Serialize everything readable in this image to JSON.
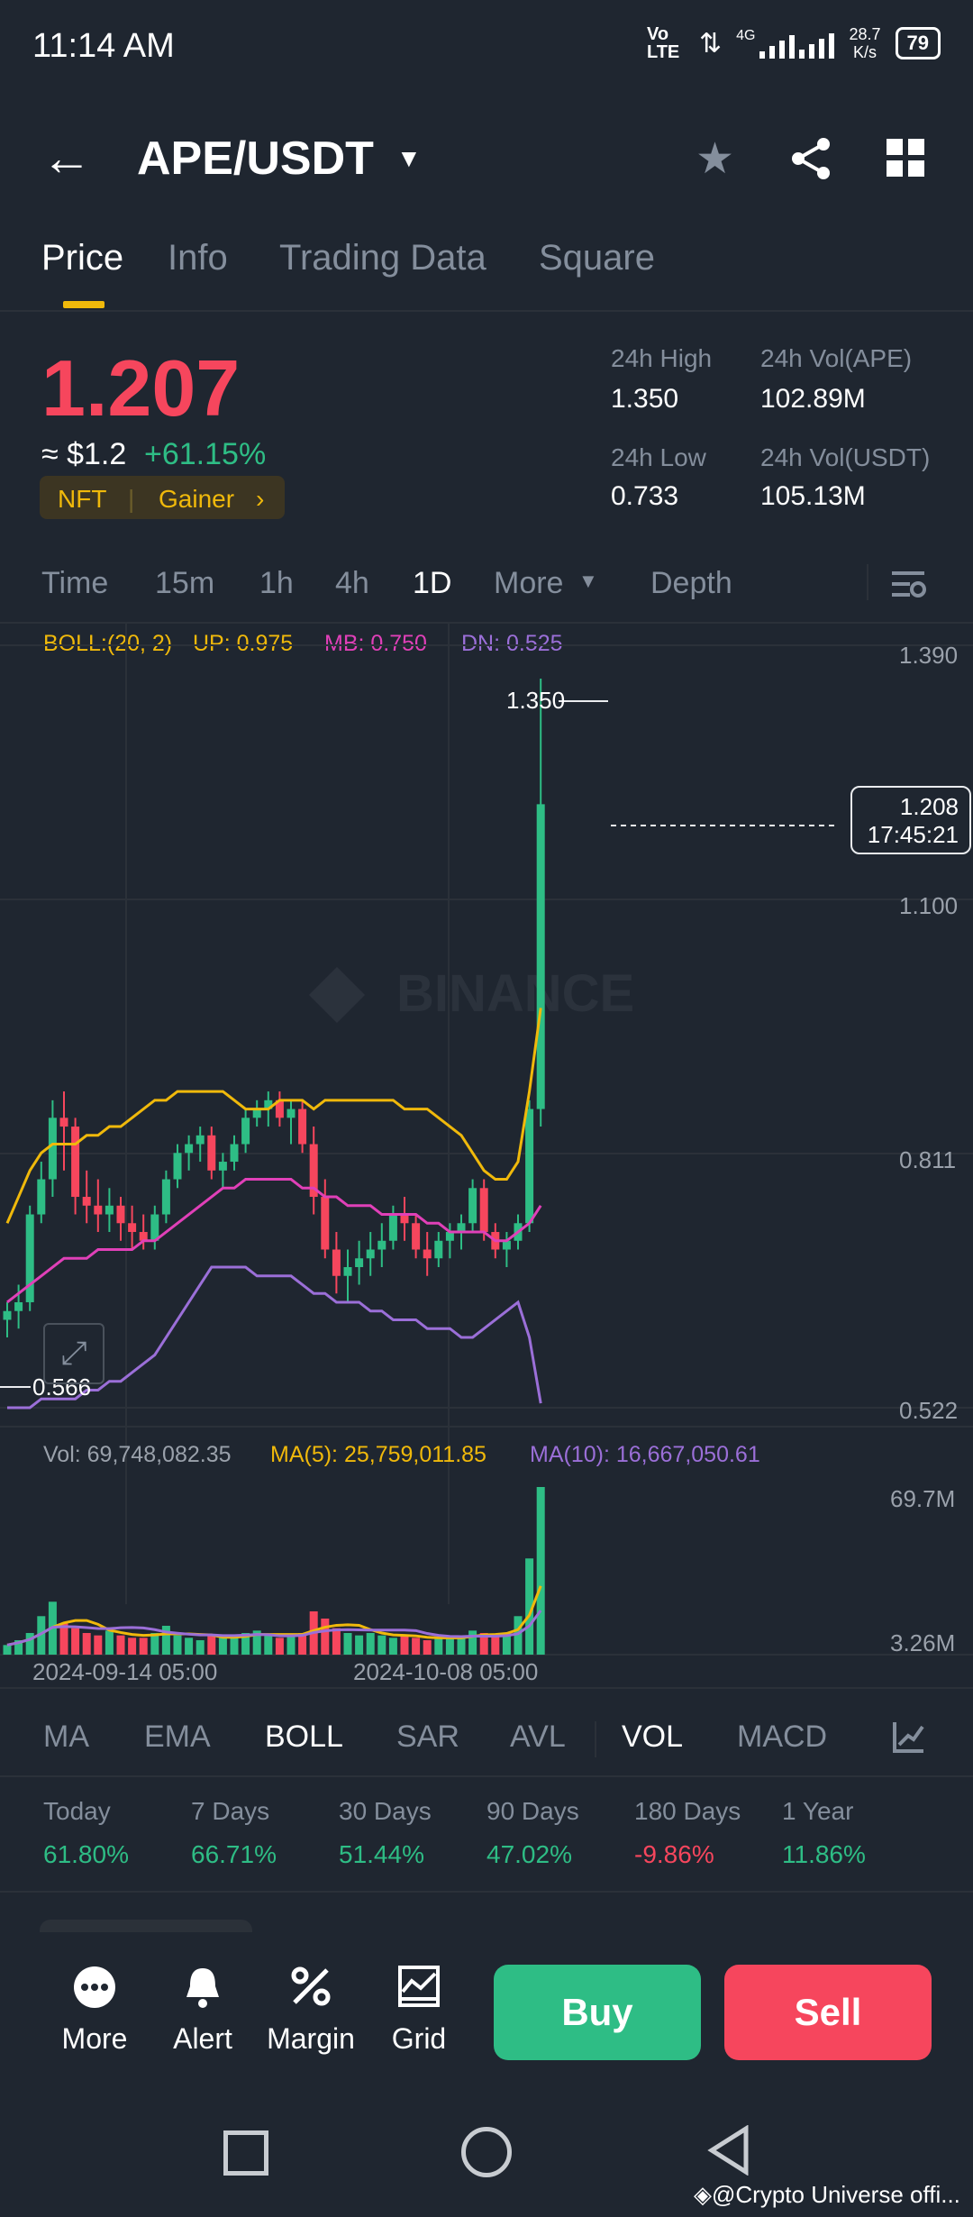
{
  "status_bar": {
    "time": "11:14 AM",
    "network_label": "Vo LTE",
    "speed": "28.7",
    "speed_unit": "K/s",
    "battery": "79",
    "net_type": "4G"
  },
  "header": {
    "pair": "APE/USDT",
    "icons": [
      "back-arrow-icon",
      "caret-down-icon",
      "star-icon",
      "share-icon",
      "grid-icon"
    ]
  },
  "tabs": [
    {
      "label": "Price",
      "active": true
    },
    {
      "label": "Info"
    },
    {
      "label": "Trading Data"
    },
    {
      "label": "Square"
    }
  ],
  "ticker": {
    "price": "1.207",
    "fiat": "≈ $1.2",
    "change": "+61.15%",
    "badge_left": "NFT",
    "badge_right": "Gainer",
    "high_label": "24h High",
    "high_value": "1.350",
    "low_label": "24h Low",
    "low_value": "0.733",
    "vol_base_label": "24h Vol(APE)",
    "vol_base_value": "102.89M",
    "vol_quote_label": "24h Vol(USDT)",
    "vol_quote_value": "105.13M"
  },
  "timeframes": [
    {
      "label": "Time"
    },
    {
      "label": "15m"
    },
    {
      "label": "1h"
    },
    {
      "label": "4h"
    },
    {
      "label": "1D",
      "active": true
    },
    {
      "label": "More"
    },
    {
      "label": "Depth"
    }
  ],
  "indicators": {
    "boll": "BOLL:(20, 2)",
    "up": "UP: 0.975",
    "mb": "MB: 0.750",
    "dn": "DN: 0.525",
    "vol": "Vol: 69,748,082.35",
    "ma5": "MA(5): 25,759,011.85",
    "ma10": "MA(10): 16,667,050.61"
  },
  "chart_axis": {
    "y1": "1.390",
    "y2": "1.100",
    "y3": "0.811",
    "y4": "0.522",
    "vol_top": "69.7M",
    "vol_bottom": "3.26M",
    "x1": "2024-09-14 05:00",
    "x2": "2024-10-08 05:00"
  },
  "chart_labels": {
    "high": "1.350",
    "low": "0.566",
    "last_price": "1.208",
    "countdown": "17:45:21",
    "watermark": "BINANCE"
  },
  "colors": {
    "up": "#2ebd85",
    "down": "#f6465d",
    "accent": "#f0b90b",
    "boll_up": "#f0b90b",
    "boll_mb": "#e040b8",
    "boll_dn": "#9b6fd8"
  },
  "chart_data": {
    "type": "candlestick",
    "ylim": [
      0.522,
      1.39
    ],
    "x_ticks": [
      "2024-09-14 05:00",
      "2024-10-08 05:00"
    ],
    "candles": [
      [
        0.62,
        0.64,
        0.6,
        0.63
      ],
      [
        0.63,
        0.66,
        0.61,
        0.64
      ],
      [
        0.64,
        0.75,
        0.63,
        0.74
      ],
      [
        0.74,
        0.8,
        0.73,
        0.78
      ],
      [
        0.78,
        0.87,
        0.76,
        0.85
      ],
      [
        0.85,
        0.88,
        0.79,
        0.84
      ],
      [
        0.84,
        0.85,
        0.74,
        0.76
      ],
      [
        0.76,
        0.79,
        0.73,
        0.75
      ],
      [
        0.75,
        0.78,
        0.72,
        0.74
      ],
      [
        0.74,
        0.77,
        0.72,
        0.75
      ],
      [
        0.75,
        0.76,
        0.71,
        0.73
      ],
      [
        0.73,
        0.75,
        0.7,
        0.72
      ],
      [
        0.72,
        0.74,
        0.7,
        0.71
      ],
      [
        0.71,
        0.75,
        0.7,
        0.74
      ],
      [
        0.74,
        0.79,
        0.73,
        0.78
      ],
      [
        0.78,
        0.82,
        0.77,
        0.81
      ],
      [
        0.81,
        0.83,
        0.79,
        0.82
      ],
      [
        0.82,
        0.84,
        0.8,
        0.83
      ],
      [
        0.83,
        0.84,
        0.78,
        0.79
      ],
      [
        0.79,
        0.81,
        0.77,
        0.8
      ],
      [
        0.8,
        0.83,
        0.79,
        0.82
      ],
      [
        0.82,
        0.86,
        0.81,
        0.85
      ],
      [
        0.85,
        0.87,
        0.84,
        0.86
      ],
      [
        0.86,
        0.88,
        0.84,
        0.87
      ],
      [
        0.87,
        0.88,
        0.84,
        0.85
      ],
      [
        0.85,
        0.87,
        0.82,
        0.86
      ],
      [
        0.86,
        0.87,
        0.81,
        0.82
      ],
      [
        0.82,
        0.84,
        0.74,
        0.76
      ],
      [
        0.76,
        0.78,
        0.69,
        0.7
      ],
      [
        0.7,
        0.72,
        0.65,
        0.67
      ],
      [
        0.67,
        0.7,
        0.64,
        0.68
      ],
      [
        0.68,
        0.71,
        0.66,
        0.69
      ],
      [
        0.69,
        0.72,
        0.67,
        0.7
      ],
      [
        0.7,
        0.73,
        0.68,
        0.71
      ],
      [
        0.71,
        0.75,
        0.7,
        0.74
      ],
      [
        0.74,
        0.76,
        0.71,
        0.73
      ],
      [
        0.73,
        0.74,
        0.69,
        0.7
      ],
      [
        0.7,
        0.72,
        0.67,
        0.69
      ],
      [
        0.69,
        0.72,
        0.68,
        0.71
      ],
      [
        0.71,
        0.73,
        0.69,
        0.72
      ],
      [
        0.72,
        0.74,
        0.7,
        0.73
      ],
      [
        0.73,
        0.78,
        0.72,
        0.77
      ],
      [
        0.77,
        0.78,
        0.71,
        0.72
      ],
      [
        0.72,
        0.73,
        0.69,
        0.7
      ],
      [
        0.7,
        0.72,
        0.68,
        0.71
      ],
      [
        0.71,
        0.74,
        0.7,
        0.73
      ],
      [
        0.73,
        0.87,
        0.72,
        0.86
      ],
      [
        0.86,
        1.35,
        0.84,
        1.207
      ]
    ],
    "volumes": [
      4,
      6,
      9,
      16,
      22,
      13,
      11,
      9,
      8,
      10,
      8,
      7,
      7,
      9,
      12,
      8,
      7,
      6,
      8,
      7,
      8,
      9,
      10,
      8,
      7,
      8,
      9,
      18,
      15,
      11,
      9,
      8,
      9,
      8,
      7,
      8,
      7,
      6,
      7,
      7,
      8,
      10,
      9,
      8,
      9,
      16,
      40,
      69.7
    ],
    "boll_up": [
      0.73,
      0.76,
      0.79,
      0.81,
      0.82,
      0.82,
      0.82,
      0.83,
      0.83,
      0.84,
      0.84,
      0.85,
      0.86,
      0.87,
      0.87,
      0.88,
      0.88,
      0.88,
      0.88,
      0.88,
      0.87,
      0.86,
      0.86,
      0.86,
      0.87,
      0.87,
      0.87,
      0.86,
      0.87,
      0.87,
      0.87,
      0.87,
      0.87,
      0.87,
      0.87,
      0.86,
      0.86,
      0.86,
      0.85,
      0.84,
      0.83,
      0.81,
      0.79,
      0.78,
      0.78,
      0.8,
      0.88,
      0.975
    ],
    "boll_mb": [
      0.64,
      0.65,
      0.66,
      0.67,
      0.68,
      0.69,
      0.69,
      0.69,
      0.7,
      0.7,
      0.7,
      0.7,
      0.71,
      0.71,
      0.72,
      0.73,
      0.74,
      0.75,
      0.76,
      0.77,
      0.77,
      0.78,
      0.78,
      0.78,
      0.78,
      0.78,
      0.77,
      0.77,
      0.76,
      0.76,
      0.75,
      0.75,
      0.75,
      0.74,
      0.74,
      0.74,
      0.74,
      0.73,
      0.73,
      0.72,
      0.72,
      0.72,
      0.72,
      0.71,
      0.71,
      0.72,
      0.73,
      0.75
    ],
    "boll_dn": [
      0.52,
      0.52,
      0.52,
      0.53,
      0.53,
      0.53,
      0.53,
      0.54,
      0.54,
      0.55,
      0.55,
      0.56,
      0.57,
      0.58,
      0.6,
      0.62,
      0.64,
      0.66,
      0.68,
      0.68,
      0.68,
      0.68,
      0.67,
      0.67,
      0.67,
      0.67,
      0.66,
      0.65,
      0.65,
      0.64,
      0.64,
      0.64,
      0.63,
      0.63,
      0.62,
      0.62,
      0.62,
      0.61,
      0.61,
      0.61,
      0.6,
      0.6,
      0.61,
      0.62,
      0.63,
      0.64,
      0.6,
      0.525
    ]
  },
  "indicator_tabs": [
    {
      "label": "MA"
    },
    {
      "label": "EMA"
    },
    {
      "label": "BOLL",
      "active": true
    },
    {
      "label": "SAR"
    },
    {
      "label": "AVL"
    },
    {
      "label": "VOL",
      "active": true
    },
    {
      "label": "MACD"
    }
  ],
  "performance": [
    {
      "label": "Today",
      "value": "61.80%",
      "dir": "up"
    },
    {
      "label": "7 Days",
      "value": "66.71%",
      "dir": "up"
    },
    {
      "label": "30 Days",
      "value": "51.44%",
      "dir": "up"
    },
    {
      "label": "90 Days",
      "value": "47.02%",
      "dir": "up"
    },
    {
      "label": "180 Days",
      "value": "-9.86%",
      "dir": "down"
    },
    {
      "label": "1 Year",
      "value": "11.86%",
      "dir": "up"
    }
  ],
  "bottom_bar": {
    "more": "More",
    "alert": "Alert",
    "margin": "Margin",
    "grid": "Grid",
    "buy": "Buy",
    "sell": "Sell"
  },
  "watermark_credit": "@Crypto Universe offi..."
}
